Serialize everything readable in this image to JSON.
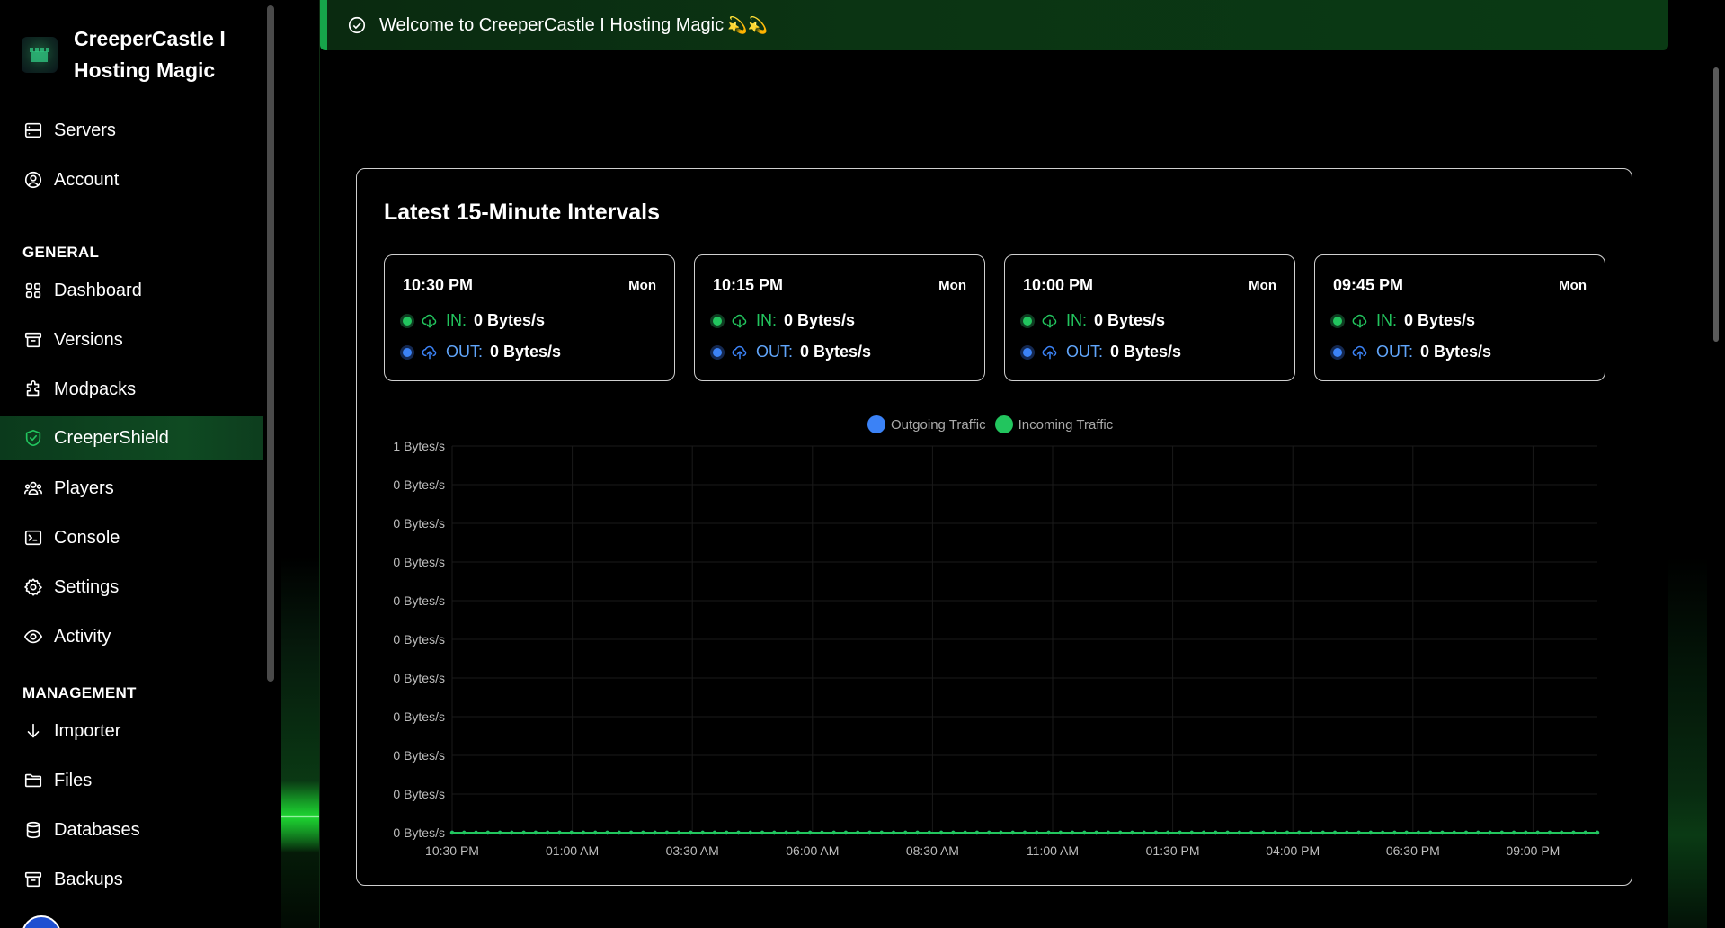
{
  "brand": {
    "name": "CreeperCastle I Hosting Magic"
  },
  "nav": {
    "top": [
      {
        "label": "Servers",
        "icon": "server-icon"
      },
      {
        "label": "Account",
        "icon": "user-circle-icon"
      }
    ],
    "general_heading": "GENERAL",
    "general": [
      {
        "label": "Dashboard",
        "icon": "grid-icon"
      },
      {
        "label": "Versions",
        "icon": "archive-icon"
      },
      {
        "label": "Modpacks",
        "icon": "puzzle-icon"
      },
      {
        "label": "CreeperShield",
        "icon": "shield-check-icon",
        "active": true
      },
      {
        "label": "Players",
        "icon": "users-icon"
      },
      {
        "label": "Console",
        "icon": "terminal-icon"
      },
      {
        "label": "Settings",
        "icon": "gear-icon"
      },
      {
        "label": "Activity",
        "icon": "eye-icon"
      }
    ],
    "management_heading": "MANAGEMENT",
    "management": [
      {
        "label": "Importer",
        "icon": "arrow-down-icon"
      },
      {
        "label": "Files",
        "icon": "folder-icon"
      },
      {
        "label": "Databases",
        "icon": "database-icon"
      },
      {
        "label": "Backups",
        "icon": "archive-icon"
      }
    ]
  },
  "banner": {
    "message": "Welcome to CreeperCastle I Hosting Magic",
    "emoji": "💫💫"
  },
  "card": {
    "title": "Latest 15-Minute Intervals",
    "in_label": "IN:",
    "out_label": "OUT:",
    "intervals": [
      {
        "time": "10:30 PM",
        "day": "Mon",
        "in": "0 Bytes/s",
        "out": "0 Bytes/s"
      },
      {
        "time": "10:15 PM",
        "day": "Mon",
        "in": "0 Bytes/s",
        "out": "0 Bytes/s"
      },
      {
        "time": "10:00 PM",
        "day": "Mon",
        "in": "0 Bytes/s",
        "out": "0 Bytes/s"
      },
      {
        "time": "09:45 PM",
        "day": "Mon",
        "in": "0 Bytes/s",
        "out": "0 Bytes/s"
      }
    ]
  },
  "colors": {
    "outgoing": "#3b82f6",
    "incoming": "#22c55e",
    "accent": "#16a34a"
  },
  "chart_data": {
    "type": "line",
    "title": "",
    "xlabel": "",
    "ylabel": "",
    "x_ticks": [
      "10:30 PM",
      "01:00 AM",
      "03:30 AM",
      "06:00 AM",
      "08:30 AM",
      "11:00 AM",
      "01:30 PM",
      "04:00 PM",
      "06:30 PM",
      "09:00 PM"
    ],
    "y_ticks": [
      "1 Bytes/s",
      "0 Bytes/s",
      "0 Bytes/s",
      "0 Bytes/s",
      "0 Bytes/s",
      "0 Bytes/s",
      "0 Bytes/s",
      "0 Bytes/s",
      "0 Bytes/s",
      "0 Bytes/s",
      "0 Bytes/s"
    ],
    "ylim": [
      0,
      1
    ],
    "legend": "top-center",
    "grid": true,
    "point_count": 97,
    "series": [
      {
        "name": "Outgoing Traffic",
        "color": "#3b82f6",
        "value": 0
      },
      {
        "name": "Incoming Traffic",
        "color": "#22c55e",
        "value": 0
      }
    ]
  }
}
